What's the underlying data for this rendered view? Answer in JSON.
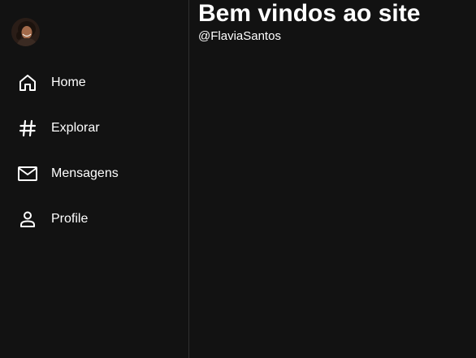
{
  "sidebar": {
    "items": [
      {
        "label": "Home",
        "icon": "home-icon"
      },
      {
        "label": "Explorar",
        "icon": "hashtag-icon"
      },
      {
        "label": "Mensagens",
        "icon": "envelope-icon"
      },
      {
        "label": "Profile",
        "icon": "person-icon"
      }
    ]
  },
  "main": {
    "title": "Bem vindos ao site",
    "username": "@FlaviaSantos"
  },
  "colors": {
    "background": "#121212",
    "text": "#ffffff",
    "divider": "#2f2f2f"
  }
}
